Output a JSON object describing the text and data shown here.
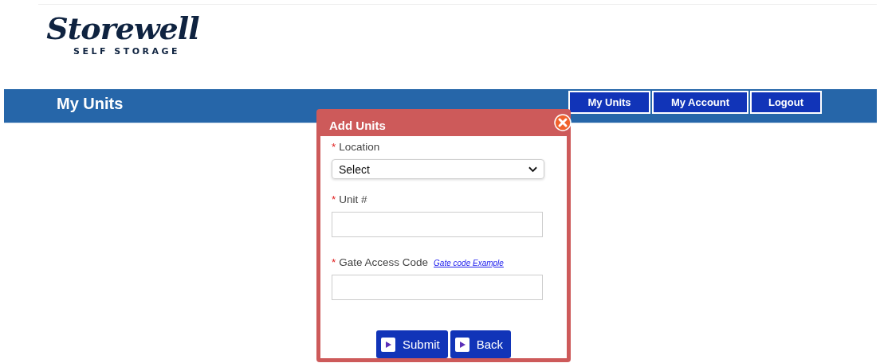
{
  "logo": {
    "name": "Storewell",
    "tagline": "SELF STORAGE"
  },
  "page_title": "My Units",
  "nav": [
    {
      "label": "My Units"
    },
    {
      "label": "My Account"
    },
    {
      "label": "Logout"
    }
  ],
  "dialog": {
    "title": "Add Units",
    "fields": [
      {
        "kind": "select",
        "required_mark": "*",
        "label": "Location",
        "value": "Select"
      },
      {
        "kind": "text",
        "required_mark": "*",
        "label": "Unit #"
      },
      {
        "kind": "text",
        "required_mark": "*",
        "label": "Gate Access Code",
        "link": "Gate code Example"
      }
    ],
    "buttons": [
      {
        "label": "Submit"
      },
      {
        "label": "Back"
      }
    ]
  }
}
